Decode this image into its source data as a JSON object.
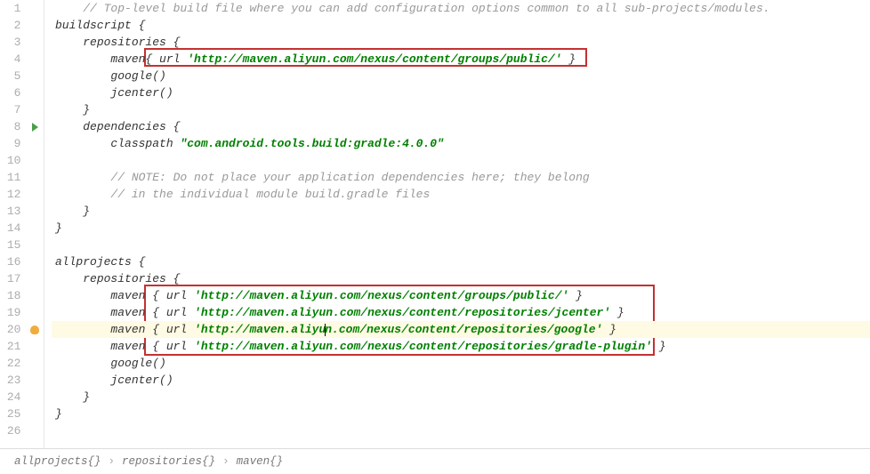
{
  "lines": [
    {
      "num": "1",
      "marker": "",
      "fold": "",
      "hl": false,
      "tokens": [
        {
          "t": "comment",
          "v": "// Top-level build file where you can add configuration options common to all sub-projects/modules."
        }
      ],
      "indent": 1
    },
    {
      "num": "2",
      "marker": "",
      "fold": "minus",
      "hl": false,
      "tokens": [
        {
          "t": "identifier",
          "v": "buildscript {"
        }
      ],
      "indent": 0
    },
    {
      "num": "3",
      "marker": "",
      "fold": "minus",
      "hl": false,
      "tokens": [
        {
          "t": "identifier",
          "v": "repositories {"
        }
      ],
      "indent": 1
    },
    {
      "num": "4",
      "marker": "",
      "fold": "",
      "hl": false,
      "tokens": [
        {
          "t": "identifier",
          "v": "maven{ url "
        },
        {
          "t": "string",
          "v": "'http://maven.aliyun.com/nexus/content/groups/public/'"
        },
        {
          "t": "identifier",
          "v": " }"
        }
      ],
      "indent": 2
    },
    {
      "num": "5",
      "marker": "",
      "fold": "",
      "hl": false,
      "tokens": [
        {
          "t": "identifier",
          "v": "google()"
        }
      ],
      "indent": 2
    },
    {
      "num": "6",
      "marker": "",
      "fold": "",
      "hl": false,
      "tokens": [
        {
          "t": "identifier",
          "v": "jcenter()"
        }
      ],
      "indent": 2
    },
    {
      "num": "7",
      "marker": "",
      "fold": "",
      "hl": false,
      "tokens": [
        {
          "t": "identifier",
          "v": "}"
        }
      ],
      "indent": 1
    },
    {
      "num": "8",
      "marker": "run",
      "fold": "minus",
      "hl": false,
      "tokens": [
        {
          "t": "identifier",
          "v": "dependencies {"
        }
      ],
      "indent": 1
    },
    {
      "num": "9",
      "marker": "",
      "fold": "",
      "hl": false,
      "tokens": [
        {
          "t": "identifier",
          "v": "classpath "
        },
        {
          "t": "string",
          "v": "\"com.android.tools.build:gradle:4.0.0\""
        }
      ],
      "indent": 2
    },
    {
      "num": "10",
      "marker": "",
      "fold": "",
      "hl": false,
      "tokens": [],
      "indent": 0
    },
    {
      "num": "11",
      "marker": "",
      "fold": "",
      "hl": false,
      "tokens": [
        {
          "t": "comment",
          "v": "// NOTE: Do not place your application dependencies here; they belong"
        }
      ],
      "indent": 2
    },
    {
      "num": "12",
      "marker": "",
      "fold": "",
      "hl": false,
      "tokens": [
        {
          "t": "comment",
          "v": "// in the individual module build.gradle files"
        }
      ],
      "indent": 2
    },
    {
      "num": "13",
      "marker": "",
      "fold": "",
      "hl": false,
      "tokens": [
        {
          "t": "identifier",
          "v": "}"
        }
      ],
      "indent": 1
    },
    {
      "num": "14",
      "marker": "",
      "fold": "",
      "hl": false,
      "tokens": [
        {
          "t": "identifier",
          "v": "}"
        }
      ],
      "indent": 0
    },
    {
      "num": "15",
      "marker": "",
      "fold": "",
      "hl": false,
      "tokens": [],
      "indent": 0
    },
    {
      "num": "16",
      "marker": "",
      "fold": "minus",
      "hl": false,
      "tokens": [
        {
          "t": "identifier",
          "v": "allprojects {"
        }
      ],
      "indent": 0
    },
    {
      "num": "17",
      "marker": "",
      "fold": "minus",
      "hl": false,
      "tokens": [
        {
          "t": "identifier",
          "v": "repositories {"
        }
      ],
      "indent": 1
    },
    {
      "num": "18",
      "marker": "",
      "fold": "",
      "hl": false,
      "tokens": [
        {
          "t": "identifier",
          "v": "maven { url "
        },
        {
          "t": "string",
          "v": "'http://maven.aliyun.com/nexus/content/groups/public/'"
        },
        {
          "t": "identifier",
          "v": " }"
        }
      ],
      "indent": 2
    },
    {
      "num": "19",
      "marker": "",
      "fold": "",
      "hl": false,
      "tokens": [
        {
          "t": "identifier",
          "v": "maven { url "
        },
        {
          "t": "string",
          "v": "'http://maven.aliyun.com/nexus/content/repositories/jcenter'"
        },
        {
          "t": "identifier",
          "v": " }"
        }
      ],
      "indent": 2
    },
    {
      "num": "20",
      "marker": "bulb",
      "fold": "",
      "hl": true,
      "tokens": [
        {
          "t": "identifier",
          "v": "maven { url "
        },
        {
          "t": "string",
          "v": "'http://maven.aliyun.com/nexus/content/repositories/google'"
        },
        {
          "t": "identifier",
          "v": " }"
        }
      ],
      "indent": 2,
      "caret": 39
    },
    {
      "num": "21",
      "marker": "",
      "fold": "",
      "hl": false,
      "tokens": [
        {
          "t": "identifier",
          "v": "maven { url "
        },
        {
          "t": "string",
          "v": "'http://maven.aliyun.com/nexus/content/repositories/gradle-plugin'"
        },
        {
          "t": "identifier",
          "v": " }"
        }
      ],
      "indent": 2
    },
    {
      "num": "22",
      "marker": "",
      "fold": "",
      "hl": false,
      "tokens": [
        {
          "t": "identifier",
          "v": "google()"
        }
      ],
      "indent": 2
    },
    {
      "num": "23",
      "marker": "",
      "fold": "",
      "hl": false,
      "tokens": [
        {
          "t": "identifier",
          "v": "jcenter()"
        }
      ],
      "indent": 2
    },
    {
      "num": "24",
      "marker": "",
      "fold": "",
      "hl": false,
      "tokens": [
        {
          "t": "identifier",
          "v": "}"
        }
      ],
      "indent": 1
    },
    {
      "num": "25",
      "marker": "",
      "fold": "",
      "hl": false,
      "tokens": [
        {
          "t": "identifier",
          "v": "}"
        }
      ],
      "indent": 0
    },
    {
      "num": "26",
      "marker": "",
      "fold": "",
      "hl": false,
      "tokens": [],
      "indent": 0
    }
  ],
  "breadcrumb": {
    "items": [
      "allprojects{}",
      "repositories{}",
      "maven{}"
    ]
  },
  "indent_unit": "    "
}
